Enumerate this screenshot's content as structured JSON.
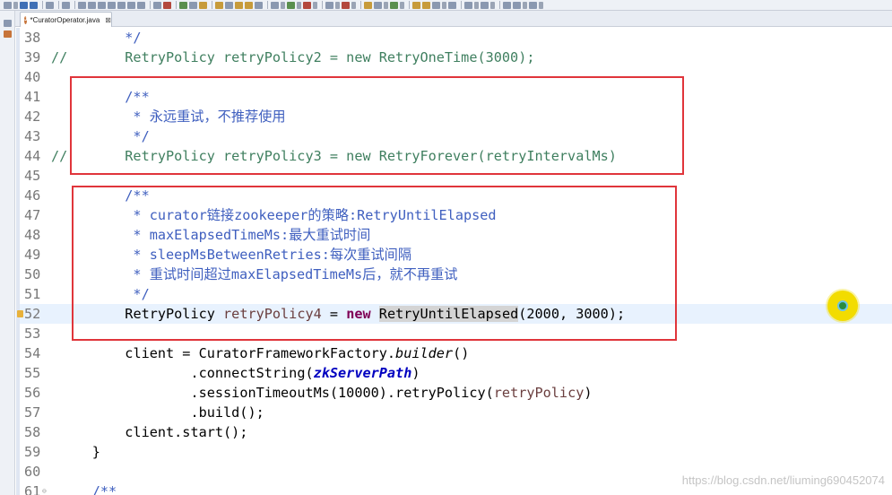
{
  "tab": {
    "label": "*CuratorOperator.java",
    "close": "⊠"
  },
  "lines": [
    {
      "num": "38",
      "text": "         */"
    },
    {
      "num": "39",
      "text": "//       RetryPolicy retryPolicy2 = new RetryOneTime(3000);"
    },
    {
      "num": "40",
      "text": ""
    },
    {
      "num": "41",
      "text": "         /**"
    },
    {
      "num": "42",
      "text": "          * 永远重试，不推荐使用"
    },
    {
      "num": "43",
      "text": "          */"
    },
    {
      "num": "44",
      "text": "//       RetryPolicy retryPolicy3 = new RetryForever(retryIntervalMs)"
    },
    {
      "num": "45",
      "text": ""
    },
    {
      "num": "46",
      "text": "         /**"
    },
    {
      "num": "47",
      "text": "          * curator链接zookeeper的策略:RetryUntilElapsed"
    },
    {
      "num": "48",
      "text": "          * maxElapsedTimeMs:最大重试时间"
    },
    {
      "num": "49",
      "text": "          * sleepMsBetweenRetries:每次重试间隔"
    },
    {
      "num": "50",
      "text": "          * 重试时间超过maxElapsedTimeMs后，就不再重试"
    },
    {
      "num": "51",
      "text": "          */"
    },
    {
      "num": "52",
      "current": true,
      "parts": {
        "a": "RetryPolicy ",
        "b": "retryPolicy4",
        "c": " = ",
        "d": "new",
        "e": " ",
        "f": "RetryUntilElapsed",
        "g": "(2000, 3000);"
      }
    },
    {
      "num": "53",
      "text": ""
    },
    {
      "num": "54",
      "parts": {
        "a": "client = CuratorFrameworkFactory.",
        "b": "builder",
        "c": "()"
      }
    },
    {
      "num": "55",
      "parts": {
        "a": ".connectString(",
        "b": "zkServerPath",
        "c": ")"
      }
    },
    {
      "num": "56",
      "parts": {
        "a": ".sessionTimeoutMs(10000).retryPolicy(",
        "b": "retryPolicy",
        "c": ")"
      }
    },
    {
      "num": "57",
      "text": "                 .build();"
    },
    {
      "num": "58",
      "text": "         client.start();"
    },
    {
      "num": "59",
      "text": "     }"
    },
    {
      "num": "60",
      "text": ""
    },
    {
      "num": "61",
      "text": "     /**"
    }
  ],
  "watermark": "https://blog.csdn.net/liuming690452074",
  "colors": {
    "box": "#e0353b",
    "comment": "#3f7f5f",
    "javadoc": "#3f5fbf",
    "keyword": "#7f0055"
  }
}
